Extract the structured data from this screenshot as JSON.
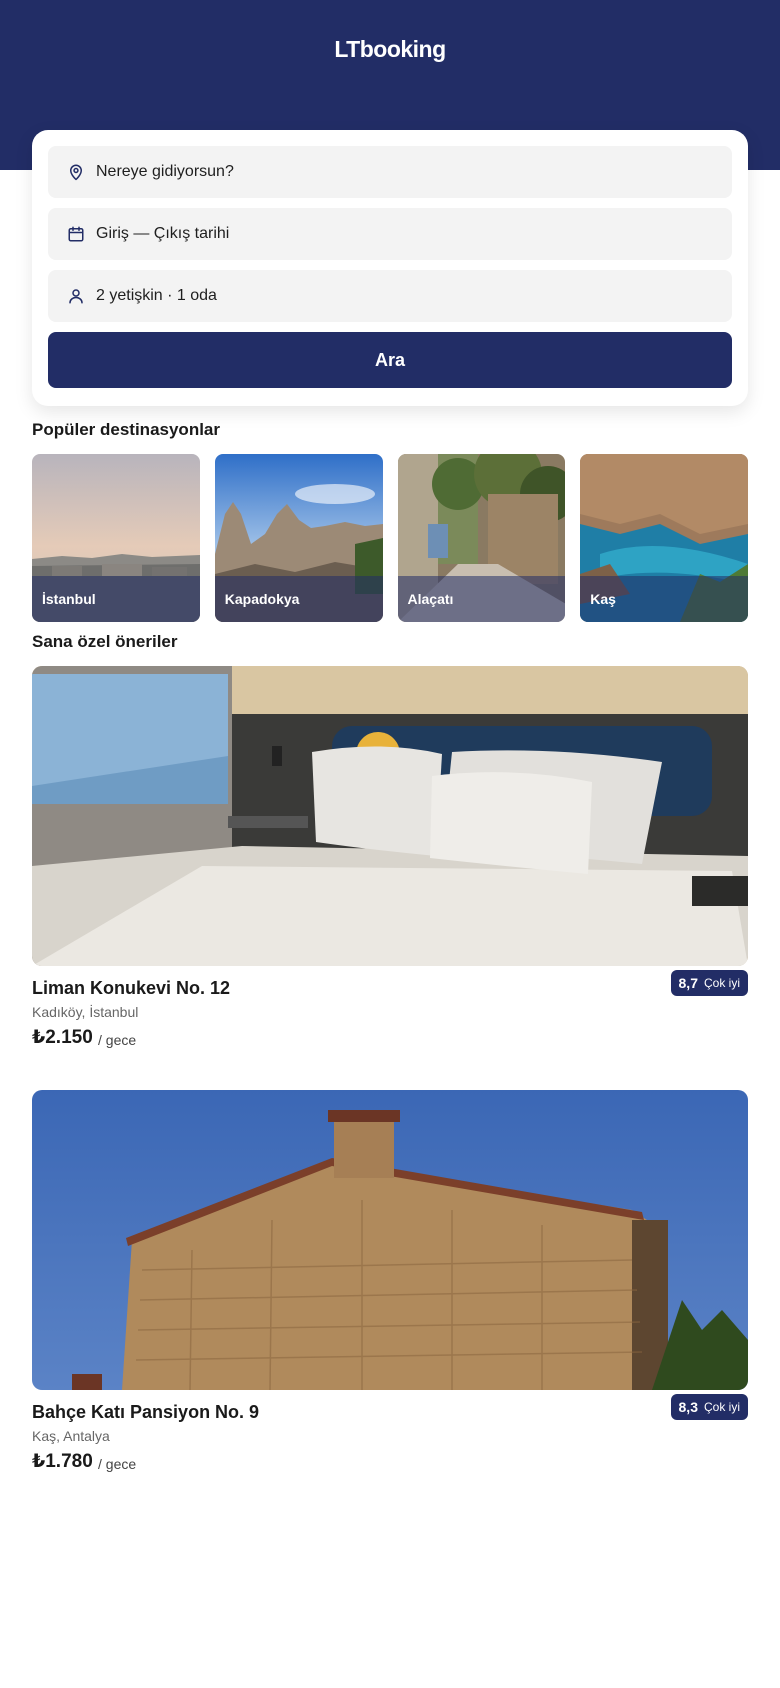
{
  "header": {
    "logo": "LTbooking",
    "background": "#222d66"
  },
  "search": {
    "destination_placeholder": "Nereye gidiyorsun?",
    "dates_placeholder": "Giriş — Çıkış tarihi",
    "guests_value": "2 yetişkin · 1 oda",
    "button_label": "Ara"
  },
  "destinations": {
    "title": "Popüler destinasyonlar",
    "items": [
      {
        "label": "İstanbul"
      },
      {
        "label": "Kapadokya"
      },
      {
        "label": "Alaçatı"
      },
      {
        "label": "Kaş"
      }
    ]
  },
  "recommendations": {
    "title": "Sana özel öneriler",
    "items": [
      {
        "name": "Liman Konukevi No. 12",
        "location": "Kadıköy, İstanbul",
        "price": "₺2.150",
        "per": "/ gece",
        "score": "8,7",
        "score_label": "Çok iyi"
      },
      {
        "name": "Bahçe Katı Pansiyon No. 9",
        "location": "Kaş, Antalya",
        "price": "₺1.780",
        "per": "/ gece",
        "score": "8,3",
        "score_label": "Çok iyi"
      }
    ]
  },
  "colors": {
    "primary": "#222d66",
    "field_bg": "#f3f3f3"
  },
  "icons": [
    "pin-icon",
    "calendar-icon",
    "person-icon"
  ]
}
